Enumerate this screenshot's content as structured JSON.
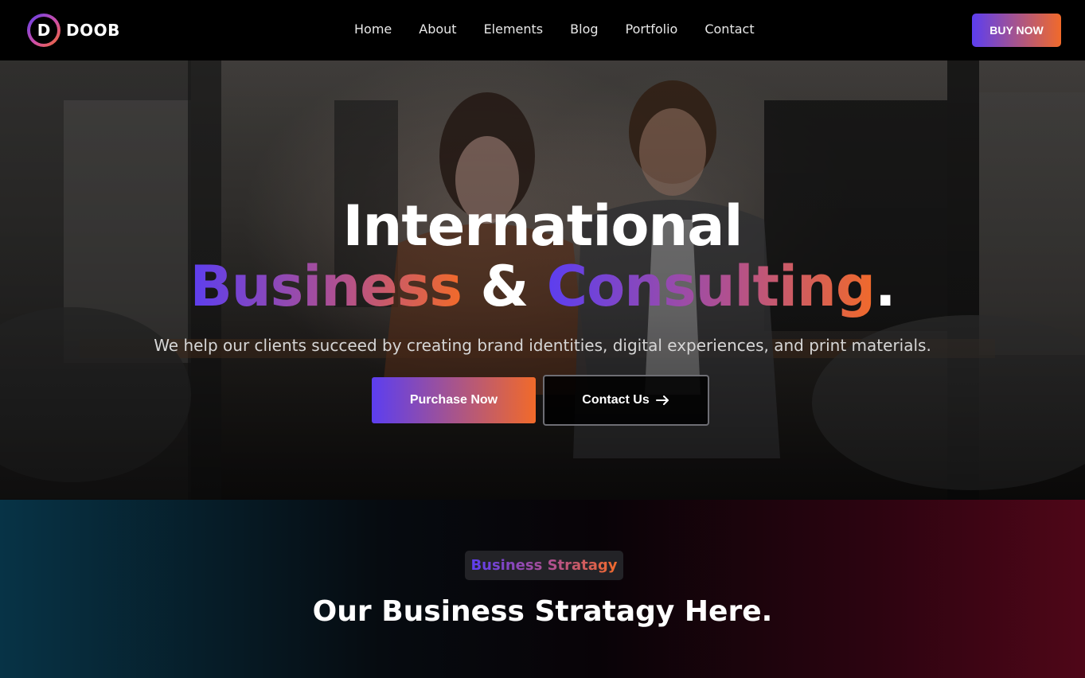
{
  "header": {
    "logo_letter": "D",
    "logo_text": "DOOB",
    "nav": [
      "Home",
      "About",
      "Elements",
      "Blog",
      "Portfolio",
      "Contact"
    ],
    "buy_button": "BUY NOW"
  },
  "hero": {
    "title_line1": "International",
    "title_word1": "Business",
    "title_amp": "&",
    "title_word2": "Consulting",
    "title_dot": ".",
    "subtitle": "We help our clients succeed by creating brand identities, digital experiences, and print materials.",
    "purchase_button": "Purchase Now",
    "contact_button": "Contact Us"
  },
  "strategy": {
    "badge": "Business Stratagy",
    "title": "Our Business Stratagy Here."
  },
  "colors": {
    "accent_start": "#5c3ef0",
    "accent_end": "#f16a2a",
    "header_bg": "#000000"
  },
  "icons": {
    "contact_arrow": "arrow-right-icon"
  }
}
